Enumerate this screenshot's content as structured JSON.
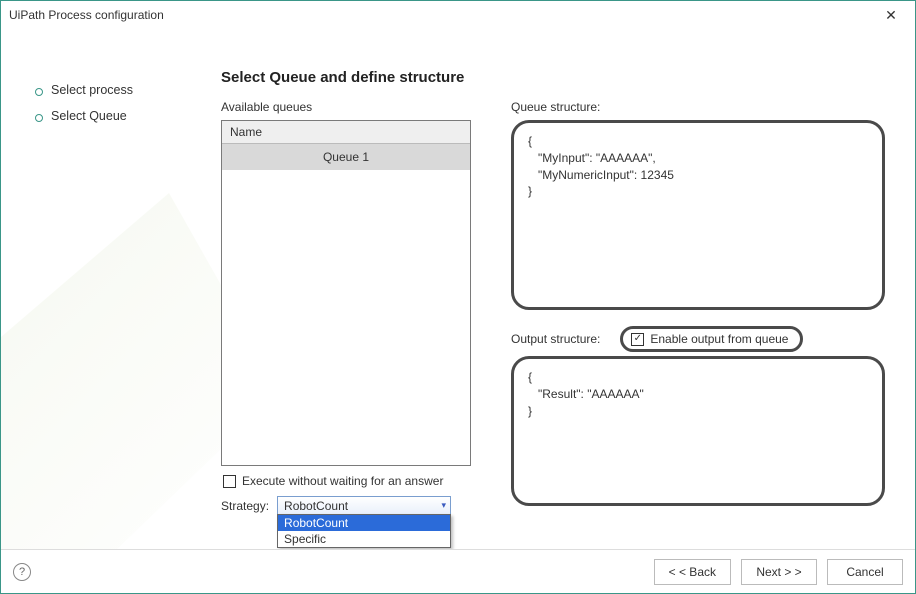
{
  "window": {
    "title": "UiPath Process configuration"
  },
  "sidebar": {
    "steps": [
      "Select process",
      "Select Queue"
    ]
  },
  "main": {
    "heading": "Select Queue and define structure",
    "availableLabel": "Available queues",
    "listHeader": "Name",
    "queues": [
      "Queue 1"
    ],
    "executeWithoutWaiting": {
      "label": "Execute without waiting for an answer",
      "checked": false
    },
    "strategyLabel": "Strategy:",
    "strategy": {
      "selected": "RobotCount",
      "options": [
        "RobotCount",
        "Specific"
      ]
    },
    "queueStructureLabel": "Queue structure:",
    "queueStructure": "{\n   \"MyInput\": \"AAAAAA\",\n   \"MyNumericInput\": 12345\n}",
    "outputStructureLabel": "Output structure:",
    "enableOutput": {
      "label": "Enable output from queue",
      "checked": true
    },
    "outputStructure": "{\n   \"Result\": \"AAAAAA\"\n}"
  },
  "footer": {
    "back": "< < Back",
    "next": "Next > >",
    "cancel": "Cancel"
  }
}
